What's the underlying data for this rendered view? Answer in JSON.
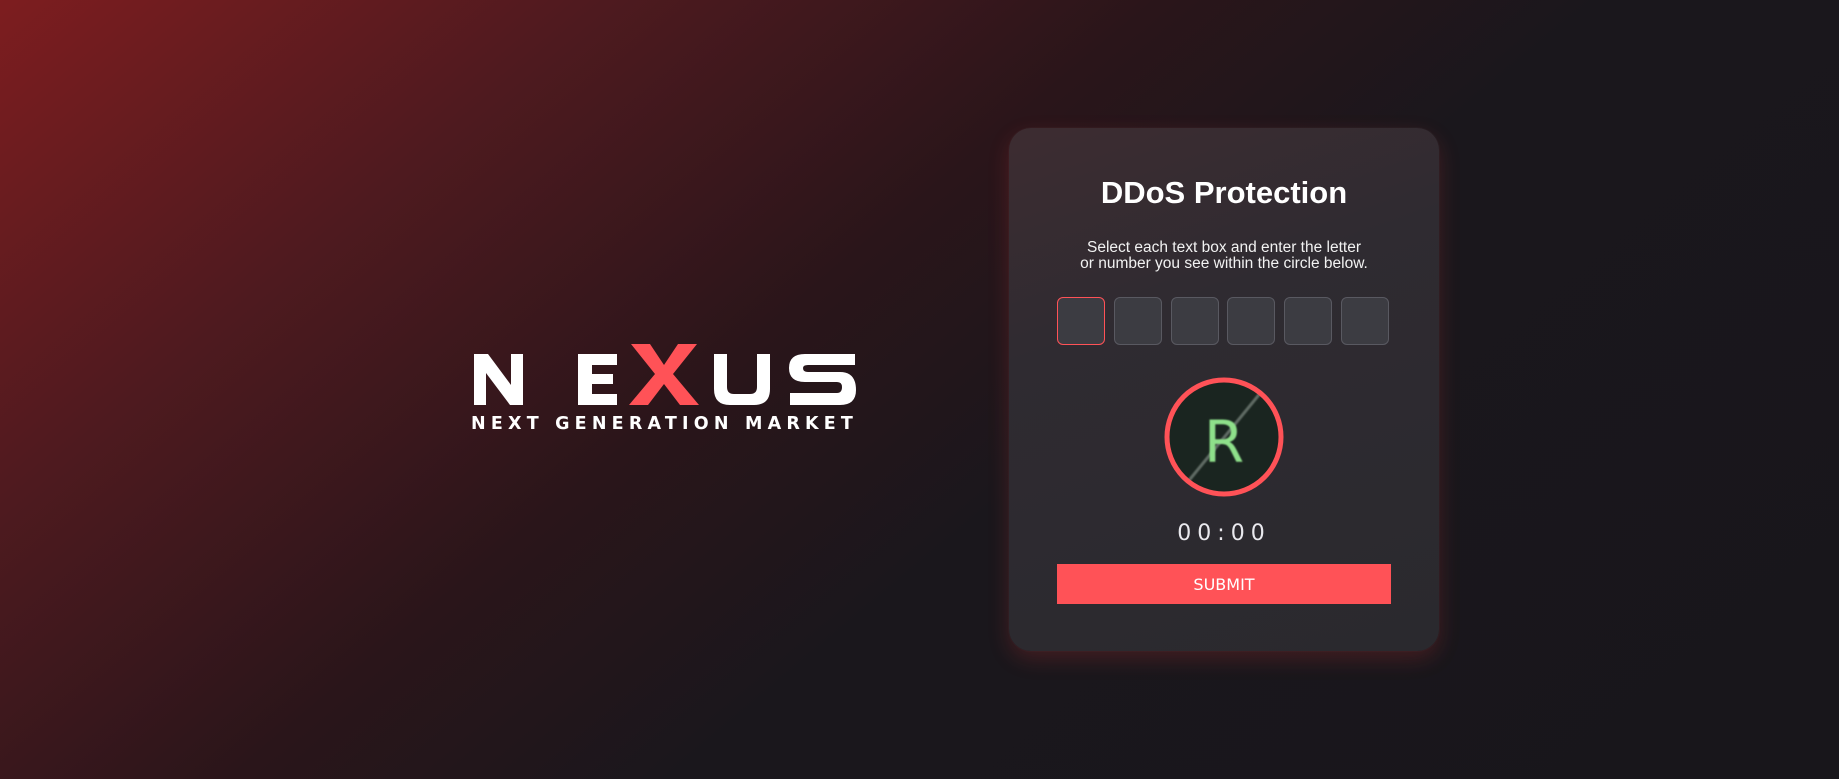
{
  "logo": {
    "name": "NEXUS",
    "letters": [
      "N",
      "E",
      "X",
      "U",
      "S"
    ],
    "tagline": "NEXT GENERATION MARKET",
    "accent_color": "#ff5257",
    "text_color": "#ffffff"
  },
  "card": {
    "title": "DDoS Protection",
    "instructions_line1": "Select each text box and enter the letter",
    "instructions_line2": "or number you see within the circle below.",
    "code_inputs": [
      "",
      "",
      "",
      "",
      "",
      ""
    ],
    "captcha_character": "R",
    "timer": "00:00",
    "submit_label": "SUBMIT"
  },
  "colors": {
    "accent": "#ff5257",
    "captcha_glyph": "#8ee08a",
    "background_dark": "#18161b",
    "background_red": "#7d1d1f"
  }
}
